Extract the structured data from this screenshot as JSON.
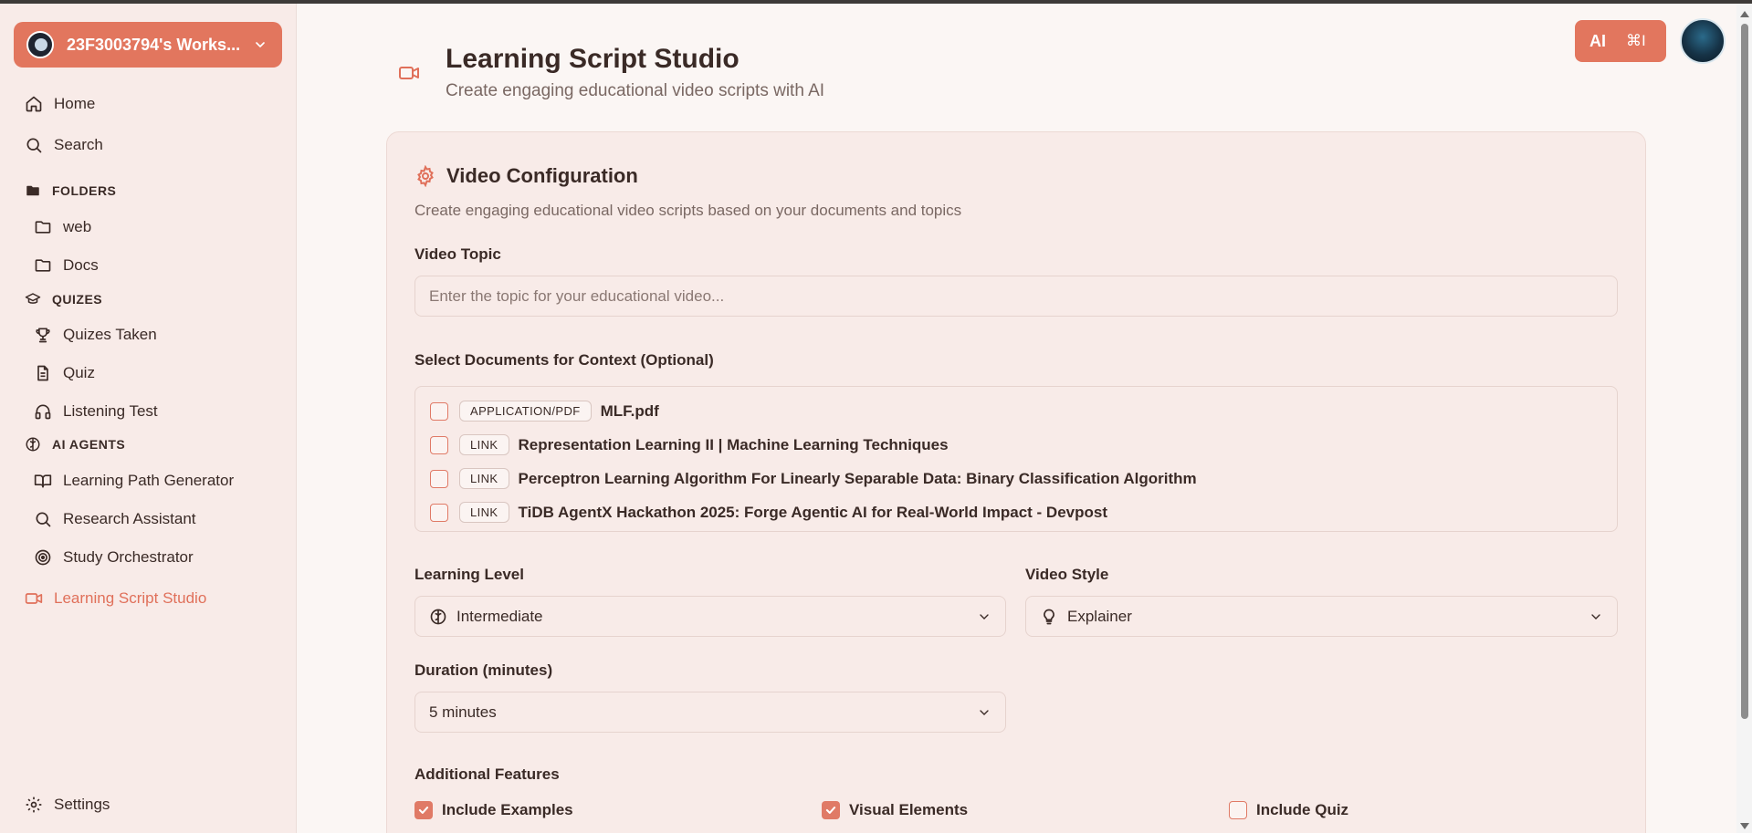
{
  "workspace": {
    "name": "23F3003794's Works..."
  },
  "nav": {
    "home": "Home",
    "search": "Search",
    "folders_section": "FOLDERS",
    "folders": [
      "web",
      "Docs"
    ],
    "quizes_section": "QUIZES",
    "quizes": [
      "Quizes Taken",
      "Quiz",
      "Listening Test"
    ],
    "agents_section": "AI AGENTS",
    "agents": [
      "Learning Path Generator",
      "Research Assistant",
      "Study Orchestrator"
    ],
    "active": "Learning Script Studio",
    "settings": "Settings"
  },
  "topbar": {
    "ai_label": "AI",
    "ai_shortcut": "⌘I"
  },
  "header": {
    "title": "Learning Script Studio",
    "subtitle": "Create engaging educational video scripts with AI"
  },
  "config": {
    "title": "Video Configuration",
    "description": "Create engaging educational video scripts based on your documents and topics",
    "topic_label": "Video Topic",
    "topic_placeholder": "Enter the topic for your educational video...",
    "docs_label": "Select Documents for Context (Optional)",
    "documents": [
      {
        "type": "APPLICATION/PDF",
        "name": "MLF.pdf",
        "checked": false
      },
      {
        "type": "LINK",
        "name": "Representation Learning II | Machine Learning Techniques",
        "checked": false
      },
      {
        "type": "LINK",
        "name": "Perceptron Learning Algorithm For Linearly Separable Data: Binary Classification Algorithm",
        "checked": false
      },
      {
        "type": "LINK",
        "name": "TiDB AgentX Hackathon 2025: Forge Agentic AI for Real-World Impact - Devpost",
        "checked": false
      }
    ],
    "level_label": "Learning Level",
    "level_value": "Intermediate",
    "style_label": "Video Style",
    "style_value": "Explainer",
    "duration_label": "Duration (minutes)",
    "duration_value": "5 minutes",
    "features_label": "Additional Features",
    "features": [
      {
        "label": "Include Examples",
        "checked": true
      },
      {
        "label": "Visual Elements",
        "checked": true
      },
      {
        "label": "Include Quiz",
        "checked": false
      }
    ]
  },
  "colors": {
    "accent": "#e2765e",
    "sidebar_bg": "#f8ebe8",
    "page_bg": "#fbf6f4"
  }
}
